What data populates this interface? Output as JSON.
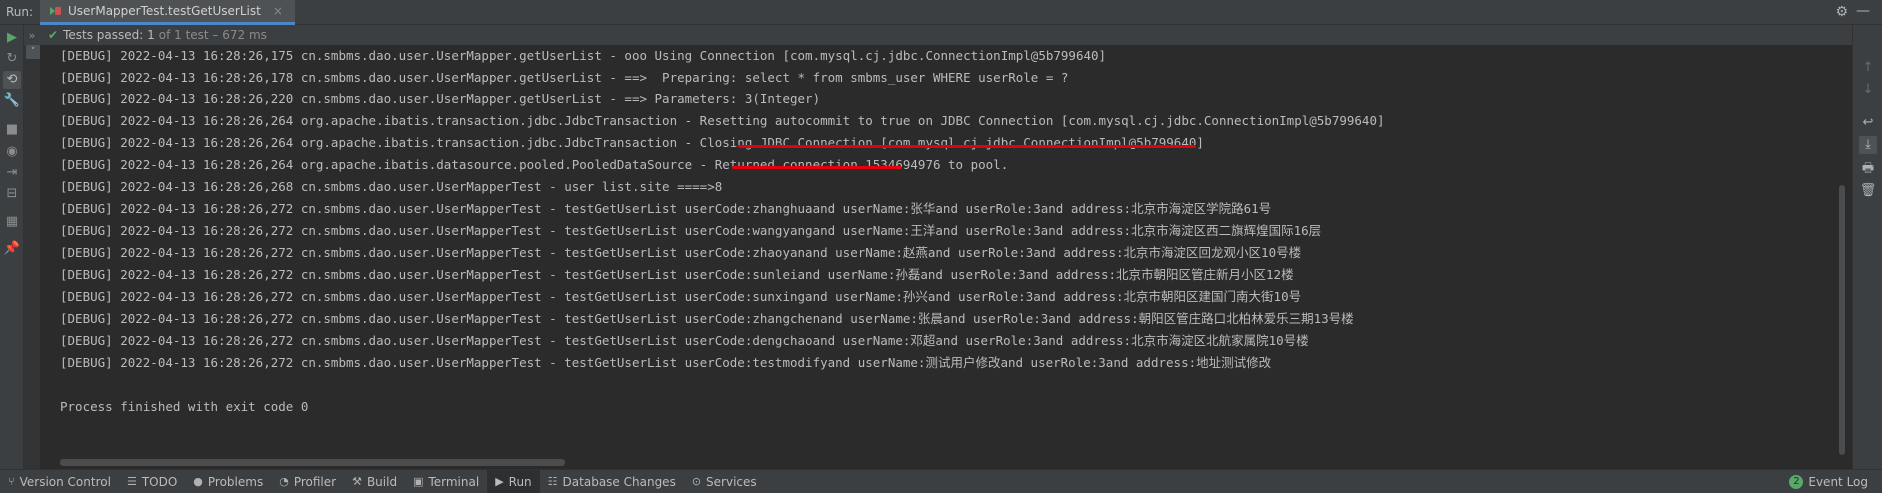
{
  "header": {
    "run_label": "Run:",
    "tab_title": "UserMapperTest.testGetUserList",
    "close_glyph": "×",
    "gear_glyph": "⚙",
    "minimize_glyph": "—"
  },
  "status": {
    "expand_glyph": "»",
    "check_glyph": "✔",
    "passed_text": "Tests passed: 1",
    "detail_text": "of 1 test – 672 ms"
  },
  "console": {
    "tree_toggle": "˅",
    "lines": [
      "[DEBUG] 2022-04-13 16:28:26,175 cn.smbms.dao.user.UserMapper.getUserList - ooo Using Connection [com.mysql.cj.jdbc.ConnectionImpl@5b799640]",
      "[DEBUG] 2022-04-13 16:28:26,178 cn.smbms.dao.user.UserMapper.getUserList - ==>  Preparing: select * from smbms_user WHERE userRole = ?",
      "[DEBUG] 2022-04-13 16:28:26,220 cn.smbms.dao.user.UserMapper.getUserList - ==> Parameters: 3(Integer)",
      "[DEBUG] 2022-04-13 16:28:26,264 org.apache.ibatis.transaction.jdbc.JdbcTransaction - Resetting autocommit to true on JDBC Connection [com.mysql.cj.jdbc.ConnectionImpl@5b799640]",
      "[DEBUG] 2022-04-13 16:28:26,264 org.apache.ibatis.transaction.jdbc.JdbcTransaction - Closing JDBC Connection [com.mysql.cj.jdbc.ConnectionImpl@5b799640]",
      "[DEBUG] 2022-04-13 16:28:26,264 org.apache.ibatis.datasource.pooled.PooledDataSource - Returned connection 1534694976 to pool.",
      "[DEBUG] 2022-04-13 16:28:26,268 cn.smbms.dao.user.UserMapperTest - user list.site ====>8",
      "[DEBUG] 2022-04-13 16:28:26,272 cn.smbms.dao.user.UserMapperTest - testGetUserList userCode:zhanghuaand userName:张华and userRole:3and address:北京市海淀区学院路61号",
      "[DEBUG] 2022-04-13 16:28:26,272 cn.smbms.dao.user.UserMapperTest - testGetUserList userCode:wangyangand userName:王洋and userRole:3and address:北京市海淀区西二旗辉煌国际16层",
      "[DEBUG] 2022-04-13 16:28:26,272 cn.smbms.dao.user.UserMapperTest - testGetUserList userCode:zhaoyanand userName:赵燕and userRole:3and address:北京市海淀区回龙观小区10号楼",
      "[DEBUG] 2022-04-13 16:28:26,272 cn.smbms.dao.user.UserMapperTest - testGetUserList userCode:sunleiand userName:孙磊and userRole:3and address:北京市朝阳区管庄新月小区12楼",
      "[DEBUG] 2022-04-13 16:28:26,272 cn.smbms.dao.user.UserMapperTest - testGetUserList userCode:sunxingand userName:孙兴and userRole:3and address:北京市朝阳区建国门南大街10号",
      "[DEBUG] 2022-04-13 16:28:26,272 cn.smbms.dao.user.UserMapperTest - testGetUserList userCode:zhangchenand userName:张晨and userRole:3and address:朝阳区管庄路口北柏林爱乐三期13号楼",
      "[DEBUG] 2022-04-13 16:28:26,272 cn.smbms.dao.user.UserMapperTest - testGetUserList userCode:dengchaoand userName:邓超and userRole:3and address:北京市海淀区北航家属院10号楼",
      "[DEBUG] 2022-04-13 16:28:26,272 cn.smbms.dao.user.UserMapperTest - testGetUserList userCode:testmodifyand userName:测试用户修改and userRole:3and address:地址测试修改",
      "",
      "Process finished with exit code 0"
    ]
  },
  "left_strip": {
    "icons": [
      {
        "name": "rerun-icon",
        "glyph": "▶"
      },
      {
        "name": "rerun-failed-icon",
        "glyph": "↻"
      },
      {
        "name": "toggle-auto-test-icon",
        "glyph": "⟲"
      },
      {
        "name": "wrench-icon",
        "glyph": "🔧"
      },
      {
        "name": "stop-icon",
        "glyph": "■"
      },
      {
        "name": "camera-icon",
        "glyph": "◉"
      },
      {
        "name": "exit-icon",
        "glyph": "⇥"
      },
      {
        "name": "restore-layout-icon",
        "glyph": "⊟"
      },
      {
        "name": "layout-icon",
        "glyph": "▦"
      },
      {
        "name": "pin-icon",
        "glyph": "📌"
      }
    ]
  },
  "right_strip": {
    "icons": [
      {
        "name": "up-arrow-icon",
        "glyph": "↑"
      },
      {
        "name": "down-arrow-icon",
        "glyph": "↓"
      },
      {
        "name": "soft-wrap-icon",
        "glyph": "↩"
      },
      {
        "name": "scroll-to-end-icon",
        "glyph": "⤓"
      },
      {
        "name": "print-icon",
        "glyph": "🖶"
      },
      {
        "name": "trash-icon",
        "glyph": "🗑"
      }
    ]
  },
  "bottom_bar": {
    "items": [
      {
        "label": "Version Control",
        "glyph": "⑂",
        "name": "version-control-tab"
      },
      {
        "label": "TODO",
        "glyph": "☰",
        "name": "todo-tab"
      },
      {
        "label": "Problems",
        "glyph": "●",
        "name": "problems-tab"
      },
      {
        "label": "Profiler",
        "glyph": "◔",
        "name": "profiler-tab"
      },
      {
        "label": "Build",
        "glyph": "⚒",
        "name": "build-tab"
      },
      {
        "label": "Terminal",
        "glyph": "▣",
        "name": "terminal-tab"
      },
      {
        "label": "Run",
        "glyph": "▶",
        "name": "run-tab"
      },
      {
        "label": "Database Changes",
        "glyph": "☷",
        "name": "database-changes-tab"
      },
      {
        "label": "Services",
        "glyph": "⊙",
        "name": "services-tab"
      }
    ],
    "active_item": "Run",
    "event_log_label": "Event Log",
    "event_log_count": "2"
  },
  "colors": {
    "accent": "#4a88c7",
    "success": "#59a869",
    "highlight_underline": "#e3000f",
    "console_bg": "#2b2b2b",
    "panel_bg": "#3c3f41"
  }
}
